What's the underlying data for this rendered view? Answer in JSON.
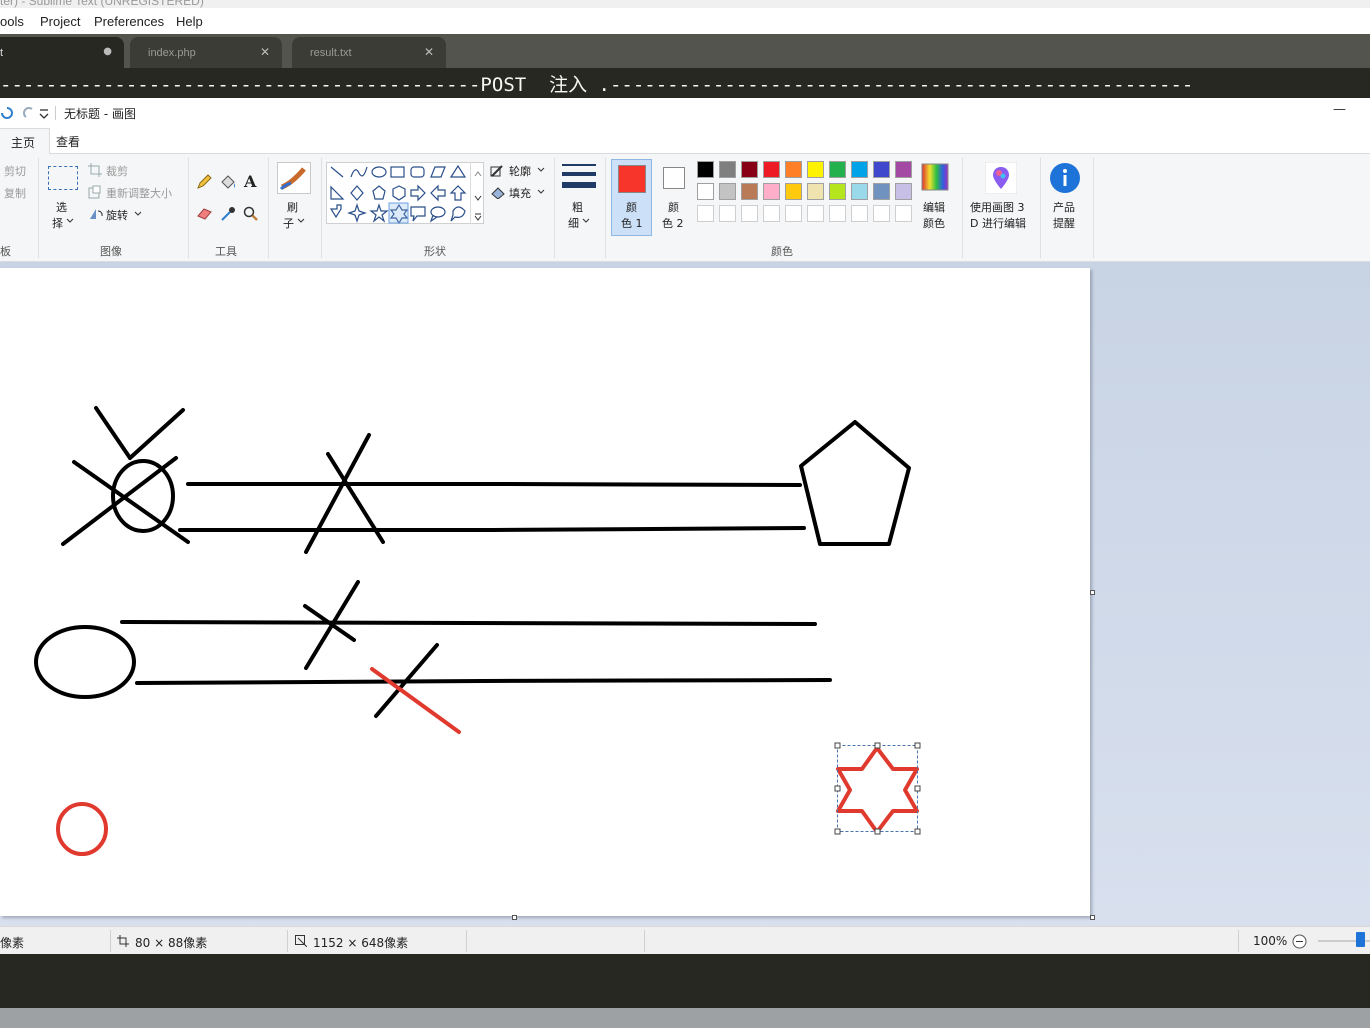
{
  "sublime": {
    "title": "ter) - Sublime Text (UNREGISTERED)",
    "menu": [
      "ools",
      "Project",
      "Preferences",
      "Help"
    ],
    "tabs": [
      {
        "label": "t",
        "close": "●"
      },
      {
        "label": "index.php",
        "close": "✕"
      },
      {
        "label": "result.txt",
        "close": "✕"
      }
    ],
    "editor_line": "------------------------------------------POST  注入 .---------------------------------------------------"
  },
  "paint": {
    "title": "无标题 - 画图",
    "minimize": "—",
    "ribbon_tabs": [
      "主页",
      "查看"
    ],
    "clipboard": {
      "cut": "剪切",
      "copy": "复制",
      "label": "板"
    },
    "image_group": {
      "select_top": "选",
      "select_bottom": "择",
      "crop": "裁剪",
      "resize": "重新调整大小",
      "rotate": "旋转",
      "label": "图像"
    },
    "tools_group": {
      "label": "工具"
    },
    "brushes": {
      "top": "刷",
      "bottom": "子"
    },
    "shapes_group": {
      "outline": "轮廓",
      "fill": "填充",
      "label": "形状"
    },
    "size": {
      "top": "粗",
      "bottom": "细"
    },
    "colors_group": {
      "color1_top": "颜",
      "color1_bottom": "色 1",
      "color2_top": "颜",
      "color2_bottom": "色 2",
      "edit_top": "编辑",
      "edit_bottom": "颜色",
      "label": "颜色",
      "color1": "#f7352a",
      "color2": "#ffffff",
      "palette_row1": [
        "#000000",
        "#7f7f7f",
        "#880015",
        "#ed1c24",
        "#ff7f27",
        "#fff200",
        "#22b14c",
        "#00a2e8",
        "#3f48cc",
        "#a349a4"
      ],
      "palette_row2": [
        "#ffffff",
        "#c3c3c3",
        "#b97a57",
        "#ffaec9",
        "#ffc90e",
        "#efe4b0",
        "#b5e61d",
        "#99d9ea",
        "#7092be",
        "#c8bfe7"
      ]
    },
    "paint3d": {
      "line1": "使用画图 3",
      "line2": "D 进行编辑"
    },
    "product": {
      "line1": "产品",
      "line2": "提醒"
    },
    "status": {
      "pos": "像素",
      "selection": "80 × 88像素",
      "canvas_size": "1152 × 648像素",
      "zoom": "100%"
    },
    "ink": {
      "black": "#000000",
      "red": "#e03a2f"
    }
  }
}
